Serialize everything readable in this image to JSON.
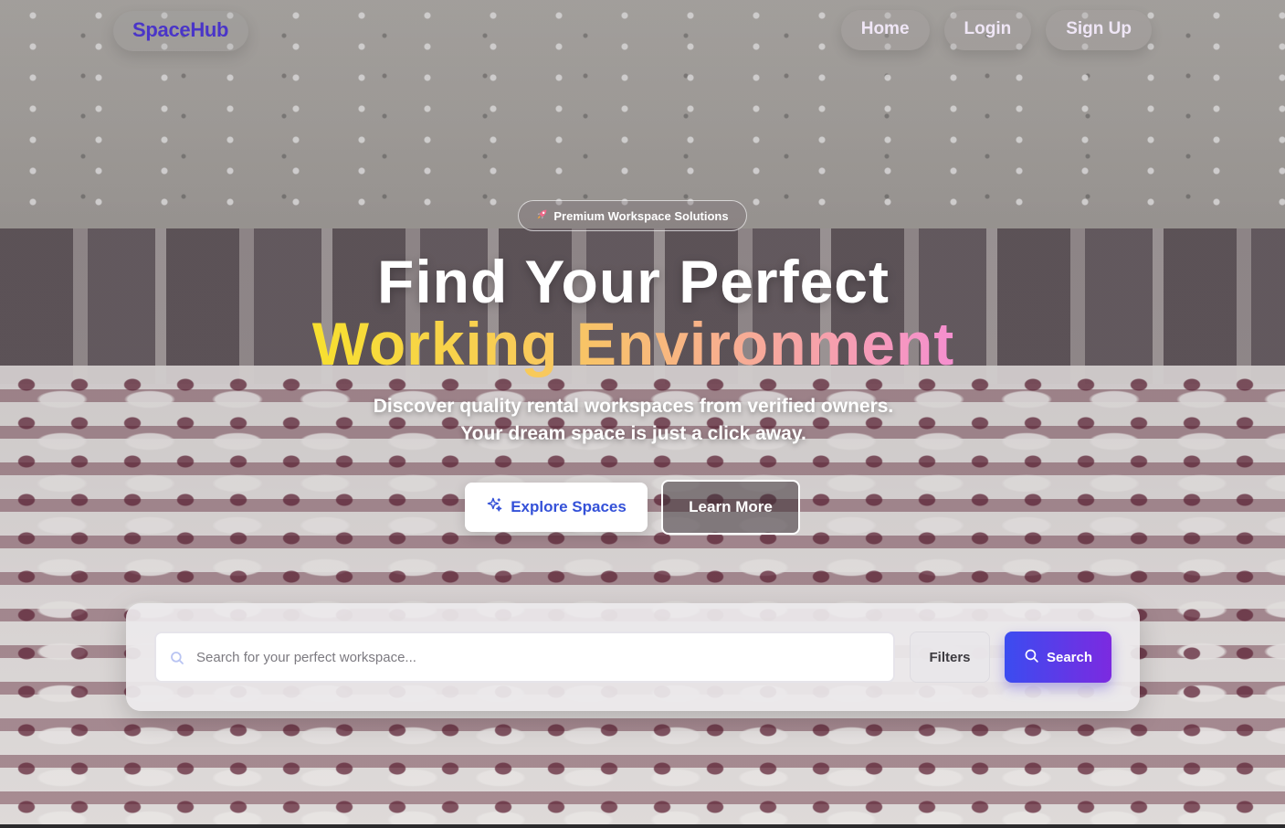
{
  "header": {
    "brand": "SpaceHub",
    "nav": [
      {
        "label": "Home"
      },
      {
        "label": "Login"
      },
      {
        "label": "Sign Up"
      }
    ]
  },
  "hero": {
    "badge": "Premium Workspace Solutions",
    "badge_icon": "rocket-icon",
    "headline_line1": "Find Your Perfect",
    "headline_line2": "Working Environment",
    "subtitle_line1": "Discover quality rental workspaces from verified owners.",
    "subtitle_line2": "Your dream space is just a click away.",
    "primary_button": "Explore Spaces",
    "primary_button_icon": "sparkles-icon",
    "secondary_button": "Learn More"
  },
  "search": {
    "placeholder": "Search for your perfect workspace...",
    "value": "",
    "filters_label": "Filters",
    "search_label": "Search"
  },
  "colors": {
    "brand": "#4a35c8",
    "accent_primary": "#3451d8",
    "search_gradient_start": "#3b4cf0",
    "search_gradient_end": "#7c2ae0",
    "headline_gradient": [
      "#f7e02f",
      "#f8c662",
      "#f7a99a",
      "#f58fd0"
    ]
  }
}
